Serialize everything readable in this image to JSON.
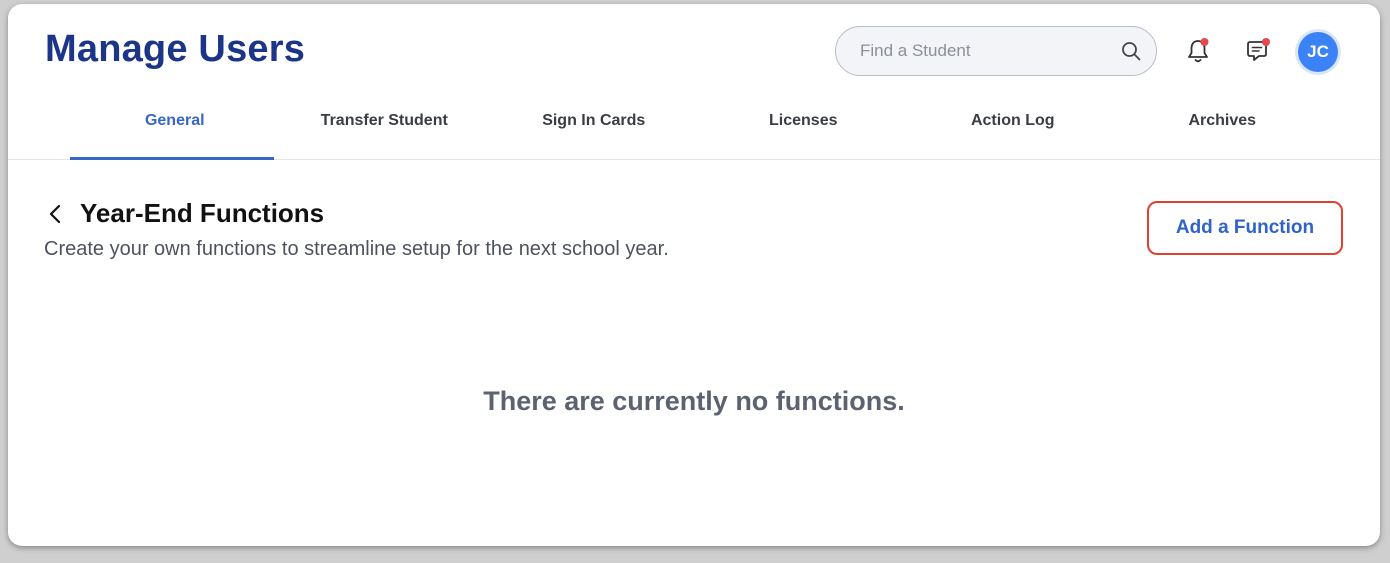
{
  "header": {
    "title": "Manage Users",
    "search": {
      "placeholder": "Find a Student",
      "value": ""
    },
    "avatar_initials": "JC"
  },
  "icons": {
    "search": "search-icon",
    "notifications": "bell-icon",
    "messages": "chat-icon",
    "back": "chevron-left-icon"
  },
  "tabs": [
    {
      "label": "General",
      "active": true
    },
    {
      "label": "Transfer Student",
      "active": false
    },
    {
      "label": "Sign In Cards",
      "active": false
    },
    {
      "label": "Licenses",
      "active": false
    },
    {
      "label": "Action Log",
      "active": false
    },
    {
      "label": "Archives",
      "active": false
    }
  ],
  "section": {
    "title": "Year-End Functions",
    "description": "Create your own functions to streamline setup for the next school year.",
    "add_button_label": "Add a Function",
    "empty_message": "There are currently no functions."
  },
  "colors": {
    "brand_title": "#1d3588",
    "accent": "#3766c8",
    "highlight_border": "#e0402f",
    "notification_dot": "#e5484d",
    "avatar_bg": "#3b82f6"
  }
}
